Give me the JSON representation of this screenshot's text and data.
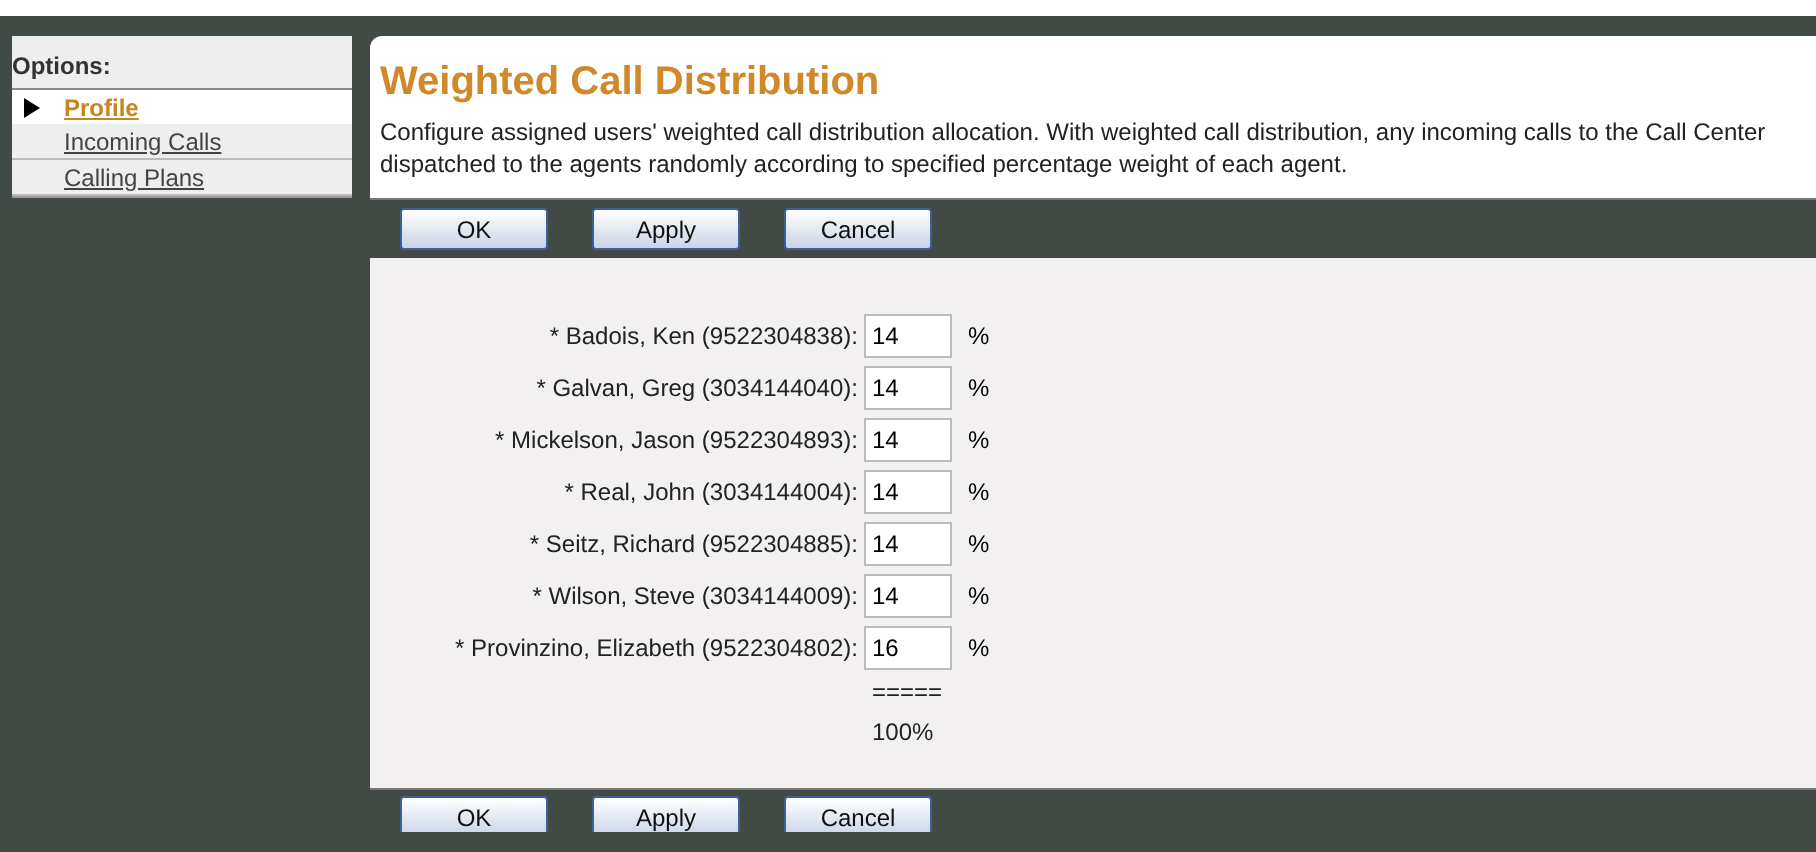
{
  "sidebar": {
    "header": "Options:",
    "items": [
      {
        "label": "Profile",
        "selected": true
      },
      {
        "label": "Incoming Calls",
        "selected": false
      },
      {
        "label": "Calling Plans",
        "selected": false
      }
    ]
  },
  "page": {
    "title": "Weighted Call Distribution",
    "description": [
      "Configure assigned users' weighted call distribution allocation. With weighted call distribution, any incoming calls to the Call Center",
      "dispatched to the agents randomly according to specified percentage weight of each agent."
    ]
  },
  "toolbar_top": [
    "OK",
    "Apply",
    "Cancel"
  ],
  "agents": [
    {
      "label": "* Badois, Ken (9522304838):",
      "value": "14",
      "unit": "%"
    },
    {
      "label": "* Galvan, Greg (3034144040):",
      "value": "14",
      "unit": "%"
    },
    {
      "label": "* Mickelson, Jason (9522304893):",
      "value": "14",
      "unit": "%"
    },
    {
      "label": "* Real, John (3034144004):",
      "value": "14",
      "unit": "%"
    },
    {
      "label": "* Seitz, Richard (9522304885):",
      "value": "14",
      "unit": "%"
    },
    {
      "label": "* Wilson, Steve (3034144009):",
      "value": "14",
      "unit": "%"
    },
    {
      "label": "* Provinzino, Elizabeth (9522304802):",
      "value": "16",
      "unit": "%"
    }
  ],
  "total": {
    "separator": "=====",
    "value": "100%"
  },
  "toolbar_bottom": [
    "OK",
    "Apply",
    "Cancel"
  ]
}
